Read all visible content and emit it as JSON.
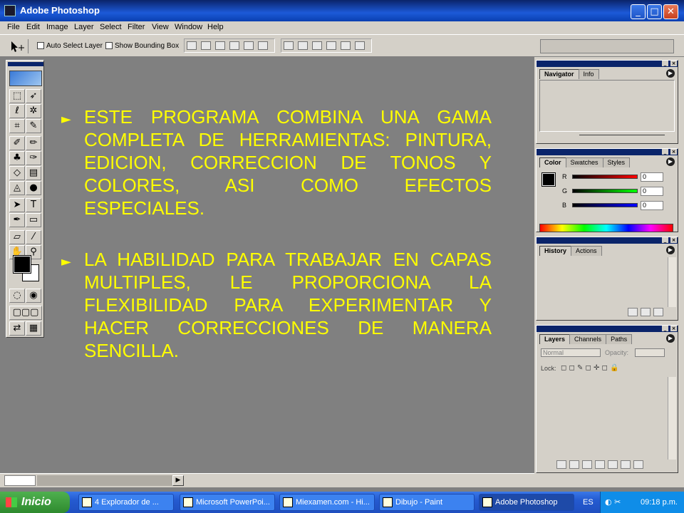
{
  "window": {
    "title": "Adobe Photoshop",
    "min": "_",
    "max": "□",
    "close": "✕"
  },
  "menu": [
    "File",
    "Edit",
    "Image",
    "Layer",
    "Select",
    "Filter",
    "View",
    "Window",
    "Help"
  ],
  "options": {
    "auto_select": "Auto Select Layer",
    "bounding_box": "Show Bounding Box"
  },
  "content": {
    "bullets": [
      "ESTE PROGRAMA COMBINA UNA GAMA COMPLETA DE HERRAMIENTAS: PINTURA, EDICION, CORRECCION DE TONOS Y COLORES, ASI COMO EFECTOS ESPECIALES.",
      "LA HABILIDAD PARA TRABAJAR EN CAPAS MULTIPLES, LE PROPORCIONA LA FLEXIBILIDAD PARA EXPERIMENTAR Y HACER CORRECCIONES DE MANERA SENCILLA."
    ],
    "bullet_glyph": "►",
    "text_color": "#ffff00",
    "background_color": "#808080"
  },
  "palettes": {
    "navigator": {
      "tabs": [
        "Navigator",
        "Info"
      ]
    },
    "color": {
      "tabs": [
        "Color",
        "Swatches",
        "Styles"
      ],
      "channels": [
        {
          "name": "R",
          "value": "0"
        },
        {
          "name": "G",
          "value": "0"
        },
        {
          "name": "B",
          "value": "0"
        }
      ]
    },
    "history": {
      "tabs": [
        "History",
        "Actions"
      ]
    },
    "layers": {
      "tabs": [
        "Layers",
        "Channels",
        "Paths"
      ],
      "blend_mode": "Normal",
      "opacity_label": "Opacity:",
      "lock_label": "Lock:"
    }
  },
  "taskbar": {
    "start": "Inicio",
    "items": [
      "4 Explorador de ...",
      "Microsoft PowerPoi...",
      "Miexamen.com - Hi...",
      "Dibujo - Paint",
      "Adobe Photoshop"
    ],
    "language": "ES",
    "clock": "09:18 p.m."
  },
  "icons": {
    "move": "move-tool-icon",
    "marquee": "marquee-tool-icon",
    "lasso": "lasso-tool-icon",
    "crop": "crop-tool-icon",
    "brush": "brush-tool-icon",
    "type": "type-tool-icon"
  }
}
